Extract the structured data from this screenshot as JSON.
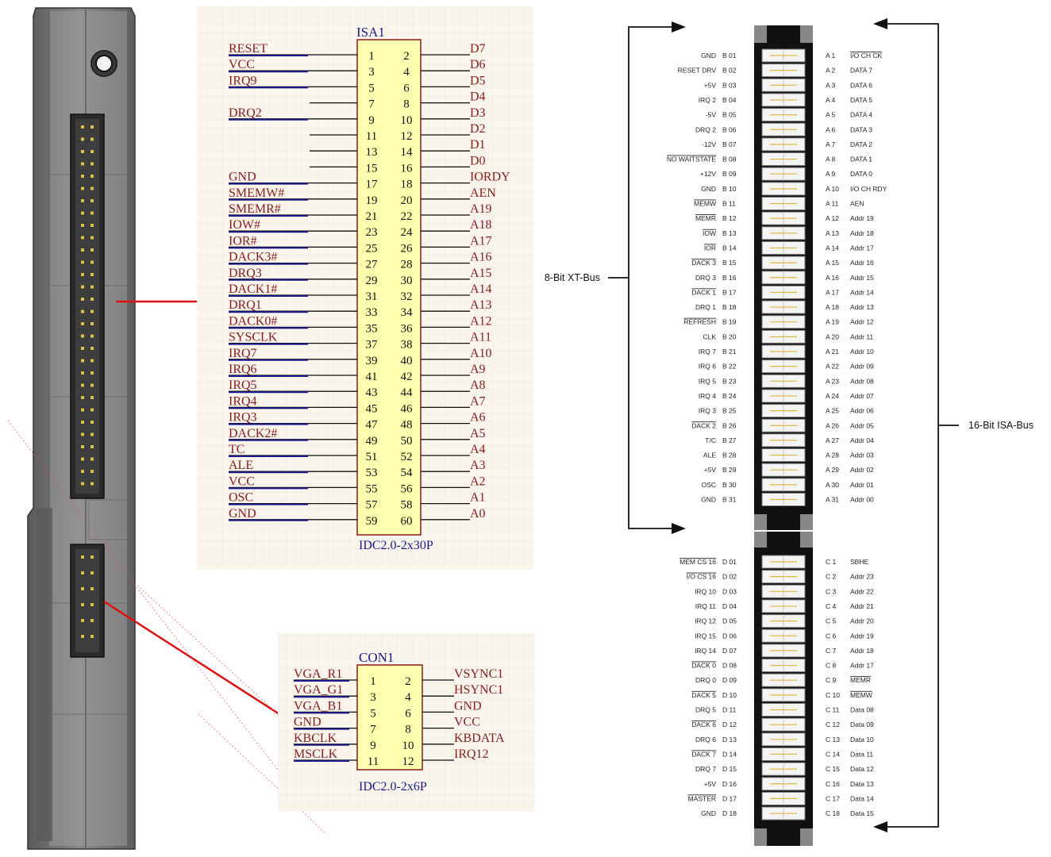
{
  "isa_schematic": {
    "designator": "ISA1",
    "footprint": "IDC2.0-2x30P",
    "left_labels": [
      "RESET",
      "VCC",
      "IRQ9",
      "",
      "DRQ2",
      "",
      "",
      "",
      "GND",
      "SMEMW#",
      "SMEMR#",
      "IOW#",
      "IOR#",
      "DACK3#",
      "DRQ3",
      "DACK1#",
      "DRQ1",
      "DACK0#",
      "SYSCLK",
      "IRQ7",
      "IRQ6",
      "IRQ5",
      "IRQ4",
      "IRQ3",
      "DACK2#",
      "TC",
      "ALE",
      "VCC",
      "OSC",
      "GND"
    ],
    "right_labels": [
      "D7",
      "D6",
      "D5",
      "D4",
      "D3",
      "D2",
      "D1",
      "D0",
      "IORDY",
      "AEN",
      "A19",
      "A18",
      "A17",
      "A16",
      "A15",
      "A14",
      "A13",
      "A12",
      "A11",
      "A10",
      "A9",
      "A8",
      "A7",
      "A6",
      "A5",
      "A4",
      "A3",
      "A2",
      "A1",
      "A0"
    ],
    "odd_pins": [
      "1",
      "3",
      "5",
      "7",
      "9",
      "11",
      "13",
      "15",
      "17",
      "19",
      "21",
      "23",
      "25",
      "27",
      "29",
      "31",
      "33",
      "35",
      "37",
      "39",
      "41",
      "43",
      "45",
      "47",
      "49",
      "51",
      "53",
      "55",
      "57",
      "59"
    ],
    "even_pins": [
      "2",
      "4",
      "6",
      "8",
      "10",
      "12",
      "14",
      "16",
      "18",
      "20",
      "22",
      "24",
      "26",
      "28",
      "30",
      "32",
      "34",
      "36",
      "38",
      "40",
      "42",
      "44",
      "46",
      "48",
      "50",
      "52",
      "54",
      "56",
      "58",
      "60"
    ]
  },
  "con_schematic": {
    "designator": "CON1",
    "footprint": "IDC2.0-2x6P",
    "left_labels": [
      "VGA_R1",
      "VGA_G1",
      "VGA_B1",
      "GND",
      "KBCLK",
      "MSCLK"
    ],
    "right_labels": [
      "VSYNC1",
      "HSYNC1",
      "GND",
      "VCC",
      "KBDATA",
      "IRQ12"
    ],
    "odd_pins": [
      "1",
      "3",
      "5",
      "7",
      "9",
      "11"
    ],
    "even_pins": [
      "2",
      "4",
      "6",
      "8",
      "10",
      "12"
    ]
  },
  "bus_labels": {
    "xt_bus": "8-Bit XT-Bus",
    "isa_bus": "16-Bit ISA-Bus"
  },
  "slot_top": {
    "rows": [
      {
        "bname": "GND",
        "bpin": "B 01",
        "apin": "A   1",
        "aname": "I/O CH CK"
      },
      {
        "bname": "RESET DRV",
        "bpin": "B 02",
        "apin": "A   2",
        "aname": "DATA 7"
      },
      {
        "bname": "+5V",
        "bpin": "B 03",
        "apin": "A   3",
        "aname": "DATA 6"
      },
      {
        "bname": "IRQ 2",
        "bpin": "B 04",
        "apin": "A   4",
        "aname": "DATA 5"
      },
      {
        "bname": "-5V",
        "bpin": "B 05",
        "apin": "A   5",
        "aname": "DATA 4"
      },
      {
        "bname": "DRQ 2",
        "bpin": "B 06",
        "apin": "A   6",
        "aname": "DATA 3"
      },
      {
        "bname": "-12V",
        "bpin": "B 07",
        "apin": "A   7",
        "aname": "DATA 2"
      },
      {
        "bname": "NO WAITSTATE",
        "bpin": "B 08",
        "apin": "A   8",
        "aname": "DATA 1"
      },
      {
        "bname": "+12V",
        "bpin": "B 09",
        "apin": "A   9",
        "aname": "DATA 0"
      },
      {
        "bname": "GND",
        "bpin": "B 10",
        "apin": "A  10",
        "aname": "I/O CH RDY"
      },
      {
        "bname": "MEMW",
        "bpin": "B 11",
        "apin": "A  11",
        "aname": "AEN"
      },
      {
        "bname": "MEMR",
        "bpin": "B 12",
        "apin": "A  12",
        "aname": "Addr 19"
      },
      {
        "bname": "IOW",
        "bpin": "B 13",
        "apin": "A  13",
        "aname": "Addr 18"
      },
      {
        "bname": "IOR",
        "bpin": "B 14",
        "apin": "A  14",
        "aname": "Addr 17"
      },
      {
        "bname": "DACK 3",
        "bpin": "B 15",
        "apin": "A  15",
        "aname": "Addr 16"
      },
      {
        "bname": "DRQ 3",
        "bpin": "B 16",
        "apin": "A  16",
        "aname": "Addr 15"
      },
      {
        "bname": "DACK 1",
        "bpin": "B 17",
        "apin": "A  17",
        "aname": "Addr 14"
      },
      {
        "bname": "DRQ 1",
        "bpin": "B 18",
        "apin": "A  18",
        "aname": "Addr 13"
      },
      {
        "bname": "REFRESH",
        "bpin": "B 19",
        "apin": "A  19",
        "aname": "Addr 12"
      },
      {
        "bname": "CLK",
        "bpin": "B 20",
        "apin": "A  20",
        "aname": "Addr 11"
      },
      {
        "bname": "IRQ 7",
        "bpin": "B 21",
        "apin": "A  21",
        "aname": "Addr 10"
      },
      {
        "bname": "IRQ 6",
        "bpin": "B 22",
        "apin": "A  22",
        "aname": "Addr 09"
      },
      {
        "bname": "IRQ 5",
        "bpin": "B 23",
        "apin": "A  23",
        "aname": "Addr 08"
      },
      {
        "bname": "IRQ 4",
        "bpin": "B 24",
        "apin": "A  24",
        "aname": "Addr 07"
      },
      {
        "bname": "IRQ 3",
        "bpin": "B 25",
        "apin": "A  25",
        "aname": "Addr 06"
      },
      {
        "bname": "DACK 2",
        "bpin": "B 26",
        "apin": "A  26",
        "aname": "Addr 05"
      },
      {
        "bname": "T/C",
        "bpin": "B 27",
        "apin": "A  27",
        "aname": "Addr 04"
      },
      {
        "bname": "ALE",
        "bpin": "B 28",
        "apin": "A  28",
        "aname": "Addr 03"
      },
      {
        "bname": "+5V",
        "bpin": "B 29",
        "apin": "A  29",
        "aname": "Addr 02"
      },
      {
        "bname": "OSC",
        "bpin": "B 30",
        "apin": "A  30",
        "aname": "Addr 01"
      },
      {
        "bname": "GND",
        "bpin": "B 31",
        "apin": "A  31",
        "aname": "Addr 00"
      }
    ]
  },
  "slot_bottom": {
    "rows": [
      {
        "bname": "MEM CS 16",
        "bpin": "D  01",
        "apin": "C   1",
        "aname": "SBHE"
      },
      {
        "bname": "I/O CS 16",
        "bpin": "D  02",
        "apin": "C   2",
        "aname": "Addr 23"
      },
      {
        "bname": "IRQ 10",
        "bpin": "D  03",
        "apin": "C   3",
        "aname": "Addr 22"
      },
      {
        "bname": "IRQ 11",
        "bpin": "D  04",
        "apin": "C   4",
        "aname": "Addr 21"
      },
      {
        "bname": "IRQ 12",
        "bpin": "D  05",
        "apin": "C   5",
        "aname": "Addr 20"
      },
      {
        "bname": "IRQ 15",
        "bpin": "D  06",
        "apin": "C   6",
        "aname": "Addr 19"
      },
      {
        "bname": "IRQ 14",
        "bpin": "D  07",
        "apin": "C   7",
        "aname": "Addr 18"
      },
      {
        "bname": "DACK 0",
        "bpin": "D  08",
        "apin": "C   8",
        "aname": "Addr 17"
      },
      {
        "bname": "DRQ 0",
        "bpin": "D  09",
        "apin": "C   9",
        "aname": "MEMR"
      },
      {
        "bname": "DACK 5",
        "bpin": "D  10",
        "apin": "C  10",
        "aname": "MEMW"
      },
      {
        "bname": "DRQ 5",
        "bpin": "D  11",
        "apin": "C  11",
        "aname": "Data 08"
      },
      {
        "bname": "DACK 6",
        "bpin": "D  12",
        "apin": "C  12",
        "aname": "Data 09"
      },
      {
        "bname": "DRQ 6",
        "bpin": "D  13",
        "apin": "C  13",
        "aname": "Data 10"
      },
      {
        "bname": "DACK 7",
        "bpin": "D  14",
        "apin": "C  14",
        "aname": "Data 11"
      },
      {
        "bname": "DRQ 7",
        "bpin": "D  15",
        "apin": "C  15",
        "aname": "Data 12"
      },
      {
        "bname": "+5V",
        "bpin": "D  16",
        "apin": "C  16",
        "aname": "Data 13"
      },
      {
        "bname": "MASTER",
        "bpin": "D  17",
        "apin": "C  17",
        "aname": "Data 14"
      },
      {
        "bname": "GND",
        "bpin": "D  18",
        "apin": "C  18",
        "aname": "Data 15"
      }
    ]
  },
  "colors": {
    "schematic_red": "#8b1a1a",
    "schematic_blue": "#1a1a8c",
    "body_yellow": "#ffffb0",
    "callout_red": "#e01010"
  }
}
